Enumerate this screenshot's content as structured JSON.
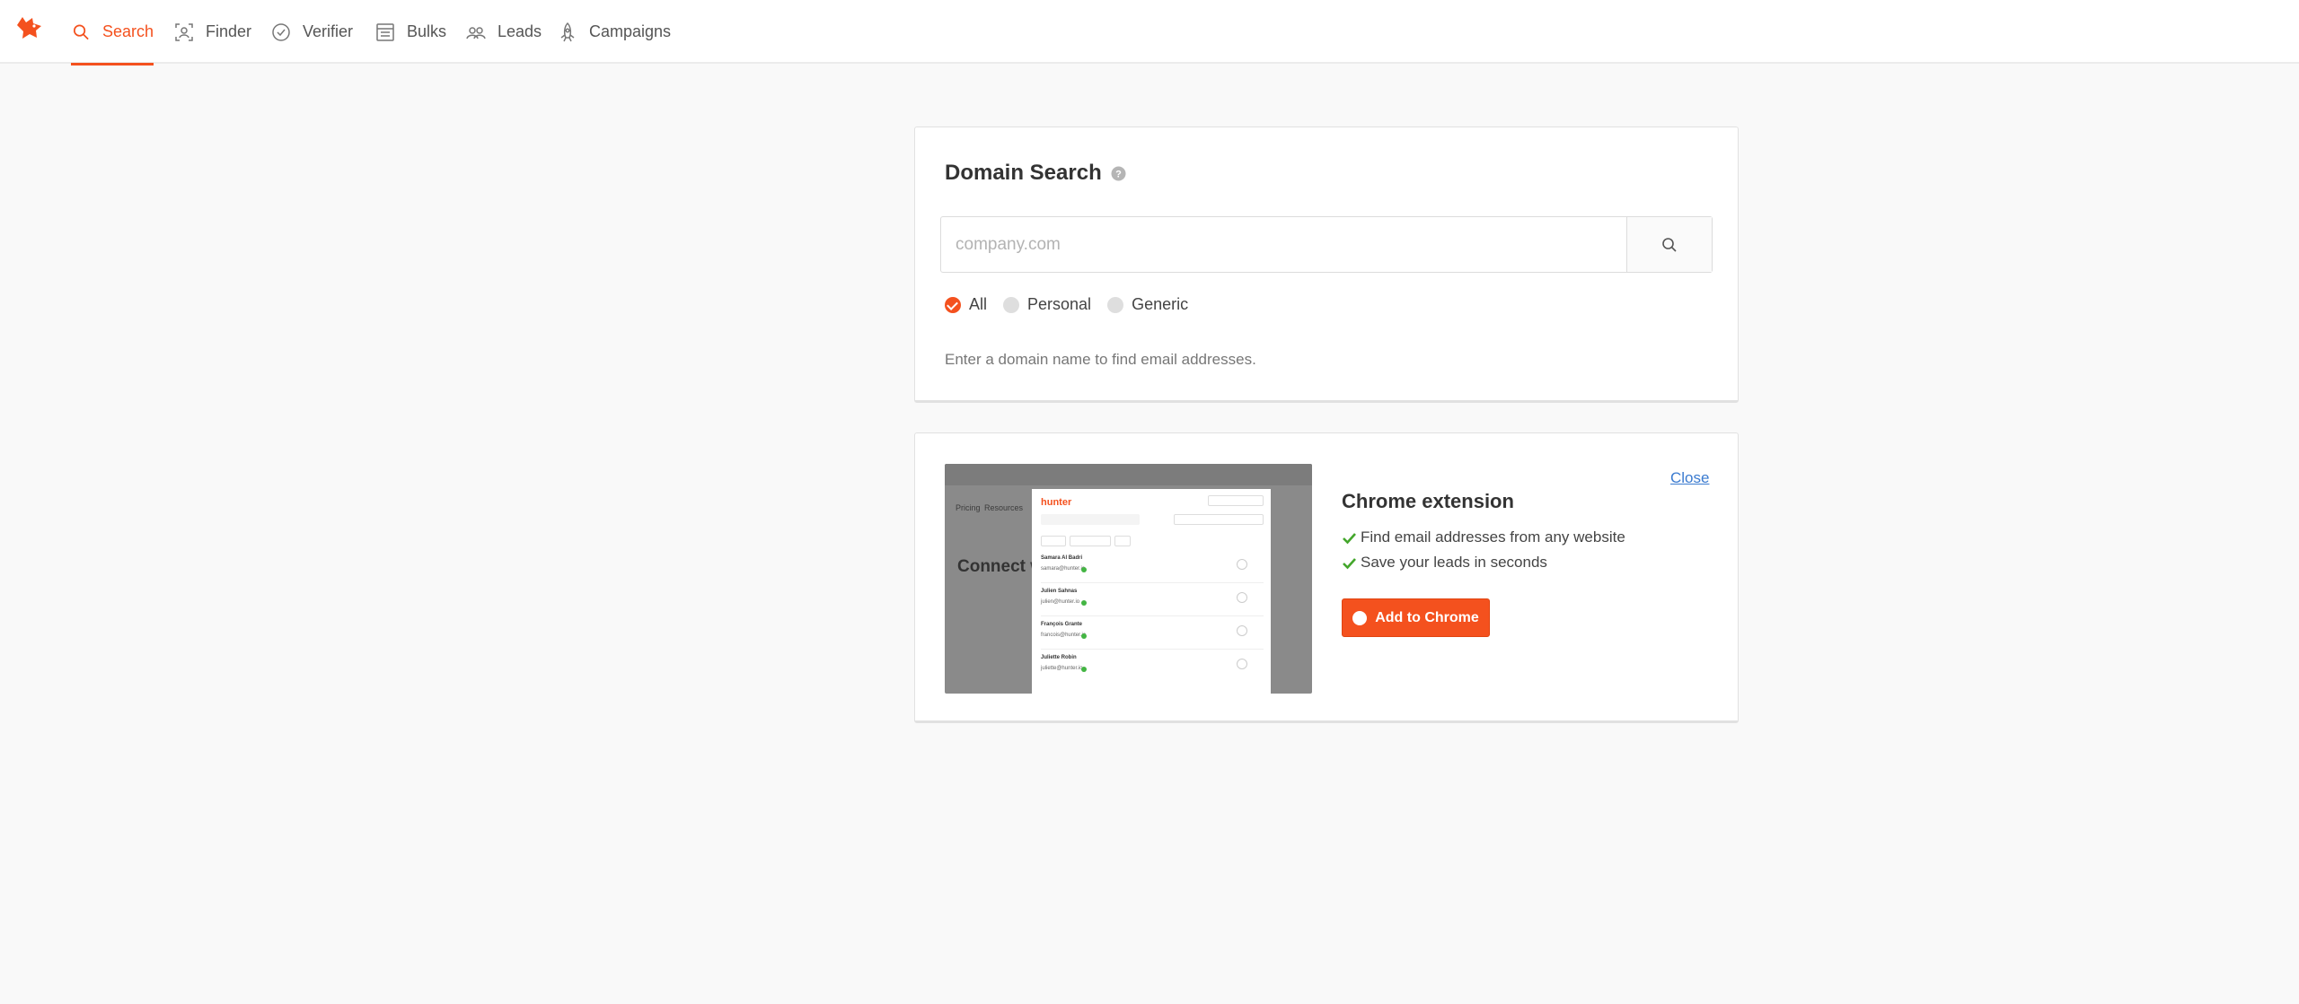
{
  "nav": {
    "items": [
      {
        "label": "Search",
        "icon": "search-icon",
        "active": true
      },
      {
        "label": "Finder",
        "icon": "finder-icon"
      },
      {
        "label": "Verifier",
        "icon": "check-circle-icon"
      },
      {
        "label": "Bulks",
        "icon": "list-icon"
      },
      {
        "label": "Leads",
        "icon": "leads-icon"
      },
      {
        "label": "Campaigns",
        "icon": "rocket-icon"
      }
    ],
    "accent": "#f4511e"
  },
  "domain_search": {
    "title": "Domain Search",
    "placeholder": "company.com",
    "value": "",
    "filters": [
      {
        "label": "All",
        "checked": true
      },
      {
        "label": "Personal",
        "checked": false
      },
      {
        "label": "Generic",
        "checked": false
      }
    ],
    "hint": "Enter a domain name to find email addresses."
  },
  "extension": {
    "close_label": "Close",
    "title": "Chrome extension",
    "features": [
      "Find email addresses from any website",
      "Save your leads in seconds"
    ],
    "button_label": "Add to Chrome",
    "preview": {
      "brand": "hunter",
      "bg_nav": [
        "Pricing",
        "Resources"
      ],
      "bg_heading": "Connect w",
      "rows": [
        {
          "name": "Samara Al Badri",
          "email": "samara@hunter.io"
        },
        {
          "name": "Julien Sahnas",
          "email": "julien@hunter.io"
        },
        {
          "name": "François Grante",
          "email": "francois@hunter.io"
        },
        {
          "name": "Juliette Robin",
          "email": "juliette@hunter.io"
        }
      ]
    }
  }
}
